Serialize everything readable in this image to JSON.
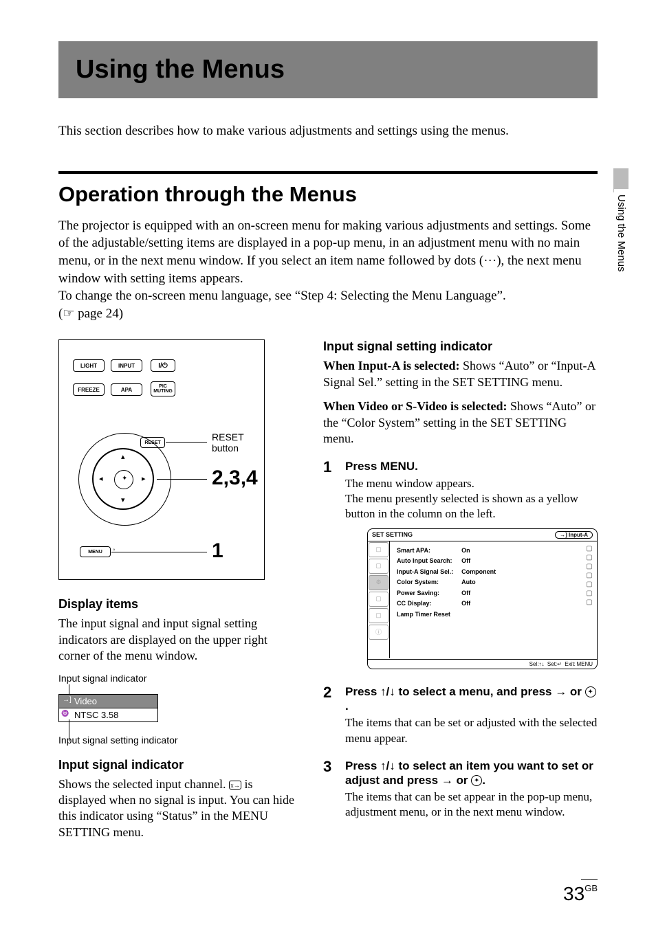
{
  "sideTab": "Using the Menus",
  "chapter": {
    "title": "Using the Menus"
  },
  "intro": "This section describes how to make various adjustments and settings using the menus.",
  "section": {
    "title": "Operation through the Menus",
    "body1": "The projector is equipped with an on-screen menu for making various adjustments and settings. Some of the adjustable/setting items are displayed in a pop-up menu, in an adjustment menu with no main menu, or in the next menu window. If you select an item name followed by dots (···), the next menu window with setting items appears.",
    "body2": "To change the on-screen menu language, see “Step 4: Selecting the Menu Language”.",
    "pageRef": "(☞ page 24)"
  },
  "remote": {
    "btnLight": "LIGHT",
    "btnInput": "INPUT",
    "btnPower": "⏼",
    "btnFreeze": "FREEZE",
    "btnApa": "APA",
    "btnPicMuting": "PIC\nMUTING",
    "btnReset": "RESET",
    "btnMenu": "MENU",
    "calloutReset": "RESET",
    "calloutResetSub": "button",
    "callout234": "2,3,4",
    "callout1": "1"
  },
  "left": {
    "h1": "Display items",
    "p1": "The input signal and input signal setting indicators are displayed on the upper right corner of the menu window.",
    "indLabelTop": "Input signal indicator",
    "indVideo": "Video",
    "indNtsc": "NTSC 3.58",
    "indLabelBottom": "Input signal setting indicator",
    "h2": "Input signal indicator",
    "p2a": "Shows the selected input channel. ",
    "p2b": " is displayed when no signal is input. You can hide this indicator using “Status” in the MENU SETTING menu."
  },
  "right": {
    "h1": "Input signal setting indicator",
    "p1a": "When Input-A is selected: ",
    "p1b": "Shows “Auto” or “Input-A Signal Sel.” setting in the SET SETTING menu.",
    "p2a": "When Video or S-Video is selected: ",
    "p2b": "Shows “Auto” or the “Color System” setting in the SET SETTING menu."
  },
  "steps": {
    "s1": {
      "num": "1",
      "title": "Press MENU.",
      "body": "The menu window appears.\nThe menu presently selected is shown as a yellow button in the column on the left."
    },
    "s2": {
      "num": "2",
      "title_pre": "Press ",
      "title_mid": " to select a menu, and press ",
      "title_or": " or ",
      "title_end": ".",
      "body": "The items that can be set or adjusted with the selected menu appear."
    },
    "s3": {
      "num": "3",
      "title_pre": "Press ",
      "title_mid": " to select an item you want to set or adjust and press ",
      "title_or": " or ",
      "title_end": ".",
      "body": "The items that can be set appear in the pop-up menu, adjustment menu, or in the next menu window."
    }
  },
  "menuShot": {
    "header": "SET SETTING",
    "inputBadge": "Input-A",
    "items": [
      [
        "Smart APA:",
        "On"
      ],
      [
        "Auto Input Search:",
        "Off"
      ],
      [
        "Input-A Signal Sel.:",
        "Component"
      ],
      [
        "Color System:",
        "Auto"
      ],
      [
        "Power Saving:",
        "Off"
      ],
      [
        "CC Display:",
        "Off"
      ],
      [
        "Lamp Timer Reset",
        ""
      ]
    ],
    "footer": "Sel:↑↓  Set:↵  Exit: MENU"
  },
  "arrows": {
    "updown": "↑/↓",
    "right": "→"
  },
  "page": {
    "num": "33",
    "suffix": "GB"
  }
}
